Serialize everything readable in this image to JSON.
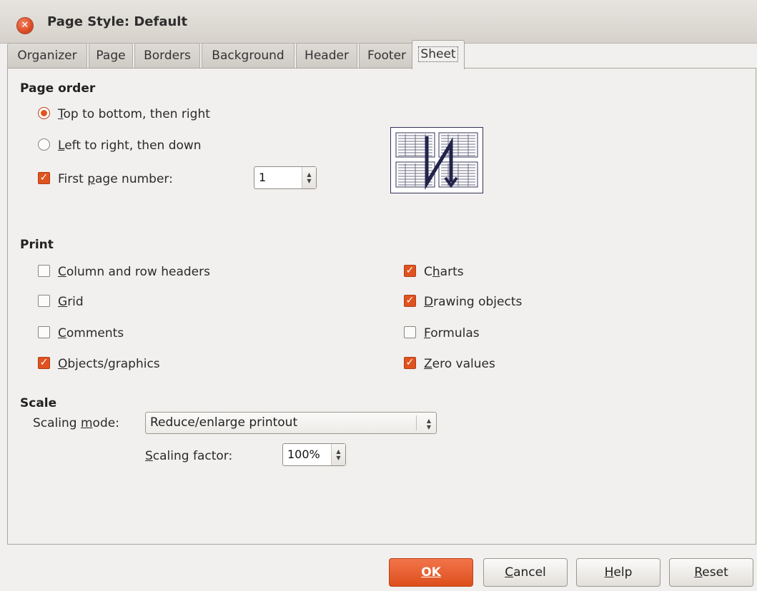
{
  "window": {
    "title": "Page Style: Default"
  },
  "tabs": [
    {
      "label": "Organizer"
    },
    {
      "label": "Page"
    },
    {
      "label": "Borders"
    },
    {
      "label": "Background"
    },
    {
      "label": "Header"
    },
    {
      "label": "Footer"
    },
    {
      "label": "Sheet"
    }
  ],
  "page_order": {
    "heading": "Page order",
    "options": [
      {
        "mn": "T",
        "rest": "op to bottom, then right",
        "selected": true
      },
      {
        "mn": "L",
        "rest": "eft to right, then down",
        "selected": false
      }
    ],
    "first_page": {
      "pre": "First ",
      "mn": "p",
      "rest": "age number:",
      "checked": true,
      "value": "1"
    }
  },
  "print": {
    "heading": "Print",
    "left": [
      {
        "mn": "C",
        "rest": "olumn and row headers",
        "checked": false
      },
      {
        "mn": "G",
        "rest": "rid",
        "checked": false
      },
      {
        "mn": "C",
        "rest": "omments",
        "checked": false
      },
      {
        "mn": "O",
        "rest": "bjects/graphics",
        "checked": true
      }
    ],
    "right": [
      {
        "pre": "C",
        "mn": "h",
        "rest": "arts",
        "checked": true
      },
      {
        "pre": "",
        "mn": "D",
        "rest": "rawing objects",
        "checked": true
      },
      {
        "pre": "",
        "mn": "F",
        "rest": "ormulas",
        "checked": false
      },
      {
        "pre": "",
        "mn": "Z",
        "rest": "ero values",
        "checked": true
      }
    ]
  },
  "scale": {
    "heading": "Scale",
    "mode_label": {
      "pre": "Scaling ",
      "mn": "m",
      "rest": "ode:"
    },
    "mode_value": "Reduce/enlarge printout",
    "factor_label": {
      "mn": "S",
      "rest": "caling factor:"
    },
    "factor_value": "100%"
  },
  "buttons": {
    "ok": "OK",
    "cancel": {
      "mn": "C",
      "rest": "ancel"
    },
    "help": {
      "mn": "H",
      "rest": "elp"
    },
    "reset": {
      "mn": "R",
      "rest": "eset"
    }
  },
  "colors": {
    "accent": "#e0531f",
    "preview_stroke": "#22234a"
  }
}
